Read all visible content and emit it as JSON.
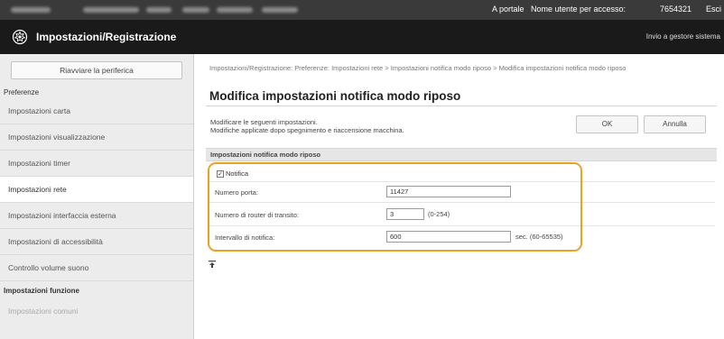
{
  "topbar": {
    "portal_link": "A portale",
    "user_label": "Nome utente per accesso:",
    "user_value": "7654321",
    "logout_link": "Esci"
  },
  "header": {
    "app_title": "Impostazioni/Registrazione",
    "send_admin_link": "Invio a gestore sistema",
    "logo_icon": "gear-icon"
  },
  "sidebar": {
    "restart_button": "Riavviare la periferica",
    "preferences_label": "Preferenze",
    "items": [
      {
        "label": "Impostazioni carta",
        "active": false
      },
      {
        "label": "Impostazioni visualizzazione",
        "active": false
      },
      {
        "label": "Impostazioni timer",
        "active": false
      },
      {
        "label": "Impostazioni rete",
        "active": true
      },
      {
        "label": "Impostazioni interfaccia esterna",
        "active": false
      },
      {
        "label": "Impostazioni di accessibilità",
        "active": false
      },
      {
        "label": "Controllo volume suono",
        "active": false
      }
    ],
    "function_settings_label": "Impostazioni funzione",
    "function_items": [
      {
        "label": "Impostazioni comuni"
      }
    ]
  },
  "main": {
    "breadcrumb": "Impostazioni/Registrazione: Preferenze: Impostazioni rete > Impostazioni notifica modo riposo > Modifica impostazioni notifica modo riposo",
    "page_title": "Modifica impostazioni notifica modo riposo",
    "instruction_line1": "Modificare le seguenti impostazioni.",
    "instruction_line2": "Modifiche applicate dopo spegnimento e riaccensione macchina.",
    "ok_button": "OK",
    "cancel_button": "Annulla",
    "panel_title": "Impostazioni notifica modo riposo",
    "notify_checkbox": {
      "label": "Notifica",
      "checked": true,
      "mark": "✓"
    },
    "port": {
      "label": "Numero porta:",
      "value": "11427"
    },
    "routers": {
      "label": "Numero di router di transito:",
      "value": "3",
      "hint": "(0-254)"
    },
    "interval": {
      "label": "Intervallo di notifica:",
      "value": "600",
      "hint": "sec. (60-65535)"
    },
    "collapse_icon": "collapse-top-icon"
  }
}
